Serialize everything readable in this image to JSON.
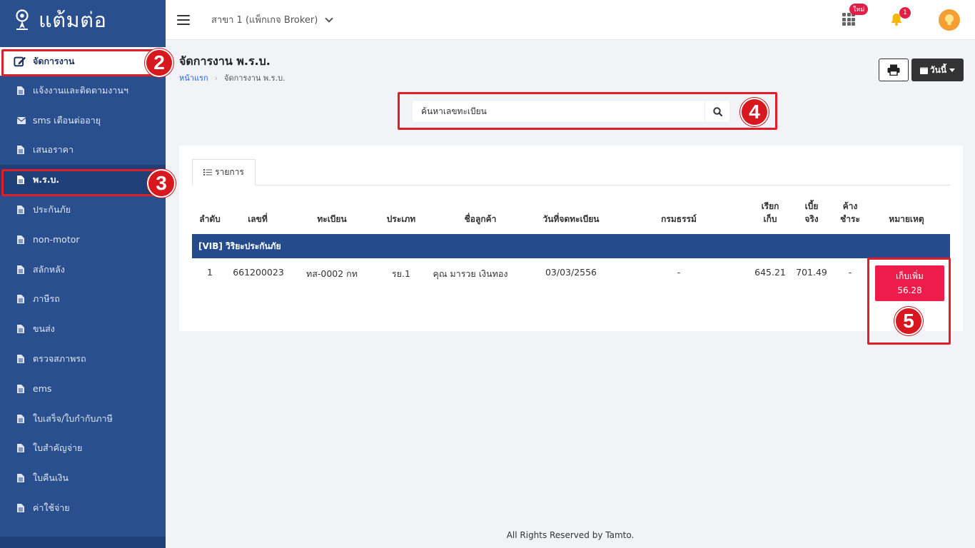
{
  "app": {
    "logo_text": "แต้มต่อ"
  },
  "sidebar": {
    "items": [
      {
        "label": "จัดการงาน",
        "icon": "edit-icon"
      },
      {
        "label": "แจ้งงานและติดตามงานฯ",
        "icon": "file-icon"
      },
      {
        "label": "sms เตือนต่ออายุ",
        "icon": "envelope-icon"
      },
      {
        "label": "เสนอราคา",
        "icon": "file-icon"
      },
      {
        "label": "พ.ร.บ.",
        "icon": "file-icon"
      },
      {
        "label": "ประกันภัย",
        "icon": "file-icon"
      },
      {
        "label": "non-motor",
        "icon": "file-icon"
      },
      {
        "label": "สลักหลัง",
        "icon": "file-icon"
      },
      {
        "label": "ภาษีรถ",
        "icon": "file-icon"
      },
      {
        "label": "ขนส่ง",
        "icon": "file-icon"
      },
      {
        "label": "ตรวจสภาพรถ",
        "icon": "file-icon"
      },
      {
        "label": "ems",
        "icon": "file-icon"
      },
      {
        "label": "ใบเสร็จ/ใบกำกับภาษี",
        "icon": "file-icon"
      },
      {
        "label": "ใบสำคัญจ่าย",
        "icon": "file-icon"
      },
      {
        "label": "ใบคืนเงิน",
        "icon": "file-icon"
      },
      {
        "label": "ค่าใช้จ่าย",
        "icon": "file-icon"
      }
    ]
  },
  "topbar": {
    "branch": "สาขา 1 (แพ็กเกจ Broker)",
    "new_badge": "ใหม่",
    "notification_count": "1"
  },
  "page": {
    "title": "จัดการงาน พ.ร.บ.",
    "breadcrumb_home": "หน้าแรก",
    "breadcrumb_current": "จัดการงาน พ.ร.บ.",
    "date_button": "วันนี้",
    "search_placeholder": "ค้นหาเลขทะเบียน"
  },
  "table": {
    "tab_label": "รายการ",
    "headers": {
      "no": "ลำดับ",
      "number": "เลขที่",
      "plate": "ทะเบียน",
      "type": "ประเภท",
      "customer": "ชื่อลูกค้า",
      "reg_date": "วันที่จดทะเบียน",
      "policy": "กรมธรรม์",
      "charge_1": "เรียก",
      "charge_2": "เก็บ",
      "net_1": "เบี้ย",
      "net_2": "จริง",
      "due_1": "ค้าง",
      "due_2": "ชำระ",
      "note": "หมายเหตุ"
    },
    "group": "[VIB] วิริยะประกันภัย",
    "rows": [
      {
        "no": "1",
        "number": "661200023",
        "plate": "ทส-0002 กท",
        "type": "รย.1",
        "customer": "คุณ มารวย เงินทอง",
        "reg_date": "03/03/2556",
        "policy": "-",
        "charge": "645.21",
        "net": "701.49",
        "due": "-",
        "note_label": "เก็บเพิ่ม",
        "note_amount": "56.28"
      }
    ]
  },
  "annotations": {
    "n2": "2",
    "n3": "3",
    "n4": "4",
    "n5": "5"
  },
  "footer": "All Rights Reserved by Tamto.",
  "colors": {
    "sidebar": "#2a4f8f",
    "accent_red": "#e11d2a",
    "collect_button": "#ed1c4a",
    "group_row": "#254b8c"
  }
}
